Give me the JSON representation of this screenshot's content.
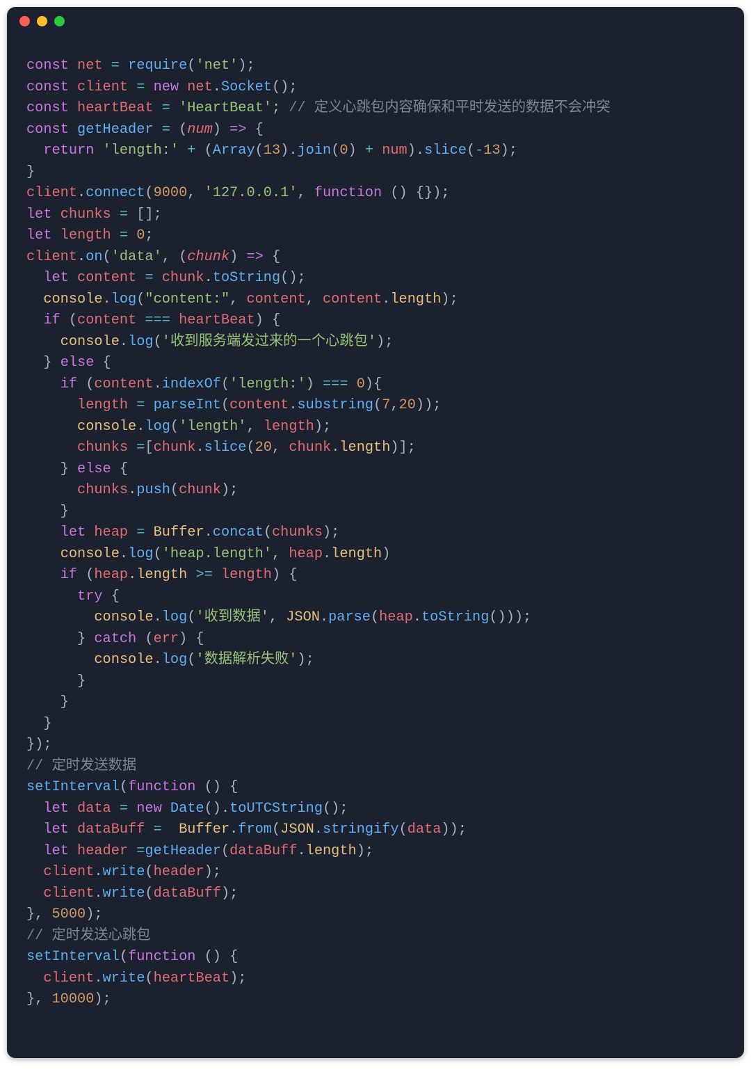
{
  "code_lines": [
    [
      [
        "kw",
        "const"
      ],
      [
        "pn",
        " "
      ],
      [
        "var",
        "net"
      ],
      [
        "pn",
        " "
      ],
      [
        "op",
        "="
      ],
      [
        "pn",
        " "
      ],
      [
        "fn",
        "require"
      ],
      [
        "pn",
        "("
      ],
      [
        "str",
        "'net'"
      ],
      [
        "pn",
        ");"
      ]
    ],
    [
      [
        "kw",
        "const"
      ],
      [
        "pn",
        " "
      ],
      [
        "var",
        "client"
      ],
      [
        "pn",
        " "
      ],
      [
        "op",
        "="
      ],
      [
        "pn",
        " "
      ],
      [
        "kw",
        "new"
      ],
      [
        "pn",
        " "
      ],
      [
        "var",
        "net"
      ],
      [
        "pn",
        "."
      ],
      [
        "fn",
        "Socket"
      ],
      [
        "pn",
        "();"
      ]
    ],
    [
      [
        "kw",
        "const"
      ],
      [
        "pn",
        " "
      ],
      [
        "var",
        "heartBeat"
      ],
      [
        "pn",
        " "
      ],
      [
        "op",
        "="
      ],
      [
        "pn",
        " "
      ],
      [
        "str",
        "'HeartBeat'"
      ],
      [
        "pn",
        "; "
      ],
      [
        "comm",
        "// 定义心跳包内容确保和平时发送的数据不会冲突"
      ]
    ],
    [
      [
        "kw",
        "const"
      ],
      [
        "pn",
        " "
      ],
      [
        "fn",
        "getHeader"
      ],
      [
        "pn",
        " "
      ],
      [
        "op",
        "="
      ],
      [
        "pn",
        " ("
      ],
      [
        "param",
        "num"
      ],
      [
        "pn",
        ") "
      ],
      [
        "kw",
        "=>"
      ],
      [
        "pn",
        " {"
      ]
    ],
    [
      [
        "pn",
        "  "
      ],
      [
        "kw",
        "return"
      ],
      [
        "pn",
        " "
      ],
      [
        "str",
        "'length:'"
      ],
      [
        "pn",
        " "
      ],
      [
        "op",
        "+"
      ],
      [
        "pn",
        " ("
      ],
      [
        "fn",
        "Array"
      ],
      [
        "pn",
        "("
      ],
      [
        "num",
        "13"
      ],
      [
        "pn",
        ")."
      ],
      [
        "fn",
        "join"
      ],
      [
        "pn",
        "("
      ],
      [
        "num",
        "0"
      ],
      [
        "pn",
        ") "
      ],
      [
        "op",
        "+"
      ],
      [
        "pn",
        " "
      ],
      [
        "var",
        "num"
      ],
      [
        "pn",
        ")."
      ],
      [
        "fn",
        "slice"
      ],
      [
        "pn",
        "("
      ],
      [
        "op",
        "-"
      ],
      [
        "num",
        "13"
      ],
      [
        "pn",
        ");"
      ]
    ],
    [
      [
        "pn",
        "}"
      ]
    ],
    [
      [
        "var",
        "client"
      ],
      [
        "pn",
        "."
      ],
      [
        "fn",
        "connect"
      ],
      [
        "pn",
        "("
      ],
      [
        "num",
        "9000"
      ],
      [
        "pn",
        ", "
      ],
      [
        "str",
        "'127.0.0.1'"
      ],
      [
        "pn",
        ", "
      ],
      [
        "kw",
        "function"
      ],
      [
        "pn",
        " () {});"
      ]
    ],
    [
      [
        "kw",
        "let"
      ],
      [
        "pn",
        " "
      ],
      [
        "var",
        "chunks"
      ],
      [
        "pn",
        " "
      ],
      [
        "op",
        "="
      ],
      [
        "pn",
        " [];"
      ]
    ],
    [
      [
        "kw",
        "let"
      ],
      [
        "pn",
        " "
      ],
      [
        "var",
        "length"
      ],
      [
        "pn",
        " "
      ],
      [
        "op",
        "="
      ],
      [
        "pn",
        " "
      ],
      [
        "num",
        "0"
      ],
      [
        "pn",
        ";"
      ]
    ],
    [
      [
        "var",
        "client"
      ],
      [
        "pn",
        "."
      ],
      [
        "fn",
        "on"
      ],
      [
        "pn",
        "("
      ],
      [
        "str",
        "'data'"
      ],
      [
        "pn",
        ", ("
      ],
      [
        "param",
        "chunk"
      ],
      [
        "pn",
        ") "
      ],
      [
        "kw",
        "=>"
      ],
      [
        "pn",
        " {"
      ]
    ],
    [
      [
        "pn",
        "  "
      ],
      [
        "kw",
        "let"
      ],
      [
        "pn",
        " "
      ],
      [
        "var",
        "content"
      ],
      [
        "pn",
        " "
      ],
      [
        "op",
        "="
      ],
      [
        "pn",
        " "
      ],
      [
        "var",
        "chunk"
      ],
      [
        "pn",
        "."
      ],
      [
        "fn",
        "toString"
      ],
      [
        "pn",
        "();"
      ]
    ],
    [
      [
        "pn",
        "  "
      ],
      [
        "obj",
        "console"
      ],
      [
        "pn",
        "."
      ],
      [
        "fn",
        "log"
      ],
      [
        "pn",
        "("
      ],
      [
        "str",
        "\"content:\""
      ],
      [
        "pn",
        ", "
      ],
      [
        "var",
        "content"
      ],
      [
        "pn",
        ", "
      ],
      [
        "var",
        "content"
      ],
      [
        "pn",
        "."
      ],
      [
        "prop",
        "length"
      ],
      [
        "pn",
        ");"
      ]
    ],
    [
      [
        "pn",
        "  "
      ],
      [
        "kw",
        "if"
      ],
      [
        "pn",
        " ("
      ],
      [
        "var",
        "content"
      ],
      [
        "pn",
        " "
      ],
      [
        "op",
        "==="
      ],
      [
        "pn",
        " "
      ],
      [
        "var",
        "heartBeat"
      ],
      [
        "pn",
        ") {"
      ]
    ],
    [
      [
        "pn",
        "    "
      ],
      [
        "obj",
        "console"
      ],
      [
        "pn",
        "."
      ],
      [
        "fn",
        "log"
      ],
      [
        "pn",
        "("
      ],
      [
        "str",
        "'收到服务端发过来的一个心跳包'"
      ],
      [
        "pn",
        ");"
      ]
    ],
    [
      [
        "pn",
        "  } "
      ],
      [
        "kw",
        "else"
      ],
      [
        "pn",
        " {"
      ]
    ],
    [
      [
        "pn",
        "    "
      ],
      [
        "kw",
        "if"
      ],
      [
        "pn",
        " ("
      ],
      [
        "var",
        "content"
      ],
      [
        "pn",
        "."
      ],
      [
        "fn",
        "indexOf"
      ],
      [
        "pn",
        "("
      ],
      [
        "str",
        "'length:'"
      ],
      [
        "pn",
        ") "
      ],
      [
        "op",
        "==="
      ],
      [
        "pn",
        " "
      ],
      [
        "num",
        "0"
      ],
      [
        "pn",
        "){"
      ]
    ],
    [
      [
        "pn",
        "      "
      ],
      [
        "var",
        "length"
      ],
      [
        "pn",
        " "
      ],
      [
        "op",
        "="
      ],
      [
        "pn",
        " "
      ],
      [
        "fn",
        "parseInt"
      ],
      [
        "pn",
        "("
      ],
      [
        "var",
        "content"
      ],
      [
        "pn",
        "."
      ],
      [
        "fn",
        "substring"
      ],
      [
        "pn",
        "("
      ],
      [
        "num",
        "7"
      ],
      [
        "pn",
        ","
      ],
      [
        "num",
        "20"
      ],
      [
        "pn",
        "));"
      ]
    ],
    [
      [
        "pn",
        "      "
      ],
      [
        "obj",
        "console"
      ],
      [
        "pn",
        "."
      ],
      [
        "fn",
        "log"
      ],
      [
        "pn",
        "("
      ],
      [
        "str",
        "'length'"
      ],
      [
        "pn",
        ", "
      ],
      [
        "var",
        "length"
      ],
      [
        "pn",
        ");"
      ]
    ],
    [
      [
        "pn",
        "      "
      ],
      [
        "var",
        "chunks"
      ],
      [
        "pn",
        " "
      ],
      [
        "op",
        "="
      ],
      [
        "pn",
        "["
      ],
      [
        "var",
        "chunk"
      ],
      [
        "pn",
        "."
      ],
      [
        "fn",
        "slice"
      ],
      [
        "pn",
        "("
      ],
      [
        "num",
        "20"
      ],
      [
        "pn",
        ", "
      ],
      [
        "var",
        "chunk"
      ],
      [
        "pn",
        "."
      ],
      [
        "prop",
        "length"
      ],
      [
        "pn",
        ")];"
      ]
    ],
    [
      [
        "pn",
        "    } "
      ],
      [
        "kw",
        "else"
      ],
      [
        "pn",
        " {"
      ]
    ],
    [
      [
        "pn",
        "      "
      ],
      [
        "var",
        "chunks"
      ],
      [
        "pn",
        "."
      ],
      [
        "fn",
        "push"
      ],
      [
        "pn",
        "("
      ],
      [
        "var",
        "chunk"
      ],
      [
        "pn",
        ");"
      ]
    ],
    [
      [
        "pn",
        "    }"
      ]
    ],
    [
      [
        "pn",
        "    "
      ],
      [
        "kw",
        "let"
      ],
      [
        "pn",
        " "
      ],
      [
        "var",
        "heap"
      ],
      [
        "pn",
        " "
      ],
      [
        "op",
        "="
      ],
      [
        "pn",
        " "
      ],
      [
        "obj",
        "Buffer"
      ],
      [
        "pn",
        "."
      ],
      [
        "fn",
        "concat"
      ],
      [
        "pn",
        "("
      ],
      [
        "var",
        "chunks"
      ],
      [
        "pn",
        ");"
      ]
    ],
    [
      [
        "pn",
        "    "
      ],
      [
        "obj",
        "console"
      ],
      [
        "pn",
        "."
      ],
      [
        "fn",
        "log"
      ],
      [
        "pn",
        "("
      ],
      [
        "str",
        "'heap.length'"
      ],
      [
        "pn",
        ", "
      ],
      [
        "var",
        "heap"
      ],
      [
        "pn",
        "."
      ],
      [
        "prop",
        "length"
      ],
      [
        "pn",
        ")"
      ]
    ],
    [
      [
        "pn",
        "    "
      ],
      [
        "kw",
        "if"
      ],
      [
        "pn",
        " ("
      ],
      [
        "var",
        "heap"
      ],
      [
        "pn",
        "."
      ],
      [
        "prop",
        "length"
      ],
      [
        "pn",
        " "
      ],
      [
        "op",
        ">="
      ],
      [
        "pn",
        " "
      ],
      [
        "var",
        "length"
      ],
      [
        "pn",
        ") {"
      ]
    ],
    [
      [
        "pn",
        "      "
      ],
      [
        "kw",
        "try"
      ],
      [
        "pn",
        " {"
      ]
    ],
    [
      [
        "pn",
        "        "
      ],
      [
        "obj",
        "console"
      ],
      [
        "pn",
        "."
      ],
      [
        "fn",
        "log"
      ],
      [
        "pn",
        "("
      ],
      [
        "str",
        "'收到数据'"
      ],
      [
        "pn",
        ", "
      ],
      [
        "obj",
        "JSON"
      ],
      [
        "pn",
        "."
      ],
      [
        "fn",
        "parse"
      ],
      [
        "pn",
        "("
      ],
      [
        "var",
        "heap"
      ],
      [
        "pn",
        "."
      ],
      [
        "fn",
        "toString"
      ],
      [
        "pn",
        "()));"
      ]
    ],
    [
      [
        "pn",
        "      } "
      ],
      [
        "kw",
        "catch"
      ],
      [
        "pn",
        " ("
      ],
      [
        "var",
        "err"
      ],
      [
        "pn",
        ") {"
      ]
    ],
    [
      [
        "pn",
        "        "
      ],
      [
        "obj",
        "console"
      ],
      [
        "pn",
        "."
      ],
      [
        "fn",
        "log"
      ],
      [
        "pn",
        "("
      ],
      [
        "str",
        "'数据解析失败'"
      ],
      [
        "pn",
        ");"
      ]
    ],
    [
      [
        "pn",
        "      }"
      ]
    ],
    [
      [
        "pn",
        "    }"
      ]
    ],
    [
      [
        "pn",
        "  }"
      ]
    ],
    [
      [
        "pn",
        "});"
      ]
    ],
    [
      [
        "comm",
        "// 定时发送数据"
      ]
    ],
    [
      [
        "fn",
        "setInterval"
      ],
      [
        "pn",
        "("
      ],
      [
        "kw",
        "function"
      ],
      [
        "pn",
        " () {"
      ]
    ],
    [
      [
        "pn",
        "  "
      ],
      [
        "kw",
        "let"
      ],
      [
        "pn",
        " "
      ],
      [
        "var",
        "data"
      ],
      [
        "pn",
        " "
      ],
      [
        "op",
        "="
      ],
      [
        "pn",
        " "
      ],
      [
        "kw",
        "new"
      ],
      [
        "pn",
        " "
      ],
      [
        "fn",
        "Date"
      ],
      [
        "pn",
        "()."
      ],
      [
        "fn",
        "toUTCString"
      ],
      [
        "pn",
        "();"
      ]
    ],
    [
      [
        "pn",
        "  "
      ],
      [
        "kw",
        "let"
      ],
      [
        "pn",
        " "
      ],
      [
        "var",
        "dataBuff"
      ],
      [
        "pn",
        " "
      ],
      [
        "op",
        "="
      ],
      [
        "pn",
        "  "
      ],
      [
        "obj",
        "Buffer"
      ],
      [
        "pn",
        "."
      ],
      [
        "fn",
        "from"
      ],
      [
        "pn",
        "("
      ],
      [
        "obj",
        "JSON"
      ],
      [
        "pn",
        "."
      ],
      [
        "fn",
        "stringify"
      ],
      [
        "pn",
        "("
      ],
      [
        "var",
        "data"
      ],
      [
        "pn",
        "));"
      ]
    ],
    [
      [
        "pn",
        "  "
      ],
      [
        "kw",
        "let"
      ],
      [
        "pn",
        " "
      ],
      [
        "var",
        "header"
      ],
      [
        "pn",
        " "
      ],
      [
        "op",
        "="
      ],
      [
        "fn",
        "getHeader"
      ],
      [
        "pn",
        "("
      ],
      [
        "var",
        "dataBuff"
      ],
      [
        "pn",
        "."
      ],
      [
        "prop",
        "length"
      ],
      [
        "pn",
        ");"
      ]
    ],
    [
      [
        "pn",
        "  "
      ],
      [
        "var",
        "client"
      ],
      [
        "pn",
        "."
      ],
      [
        "fn",
        "write"
      ],
      [
        "pn",
        "("
      ],
      [
        "var",
        "header"
      ],
      [
        "pn",
        ");"
      ]
    ],
    [
      [
        "pn",
        "  "
      ],
      [
        "var",
        "client"
      ],
      [
        "pn",
        "."
      ],
      [
        "fn",
        "write"
      ],
      [
        "pn",
        "("
      ],
      [
        "var",
        "dataBuff"
      ],
      [
        "pn",
        ");"
      ]
    ],
    [
      [
        "pn",
        "}, "
      ],
      [
        "num",
        "5000"
      ],
      [
        "pn",
        ");"
      ]
    ],
    [
      [
        "comm",
        "// 定时发送心跳包"
      ]
    ],
    [
      [
        "fn",
        "setInterval"
      ],
      [
        "pn",
        "("
      ],
      [
        "kw",
        "function"
      ],
      [
        "pn",
        " () {"
      ]
    ],
    [
      [
        "pn",
        "  "
      ],
      [
        "var",
        "client"
      ],
      [
        "pn",
        "."
      ],
      [
        "fn",
        "write"
      ],
      [
        "pn",
        "("
      ],
      [
        "var",
        "heartBeat"
      ],
      [
        "pn",
        ");"
      ]
    ],
    [
      [
        "pn",
        "}, "
      ],
      [
        "num",
        "10000"
      ],
      [
        "pn",
        ");"
      ]
    ]
  ]
}
